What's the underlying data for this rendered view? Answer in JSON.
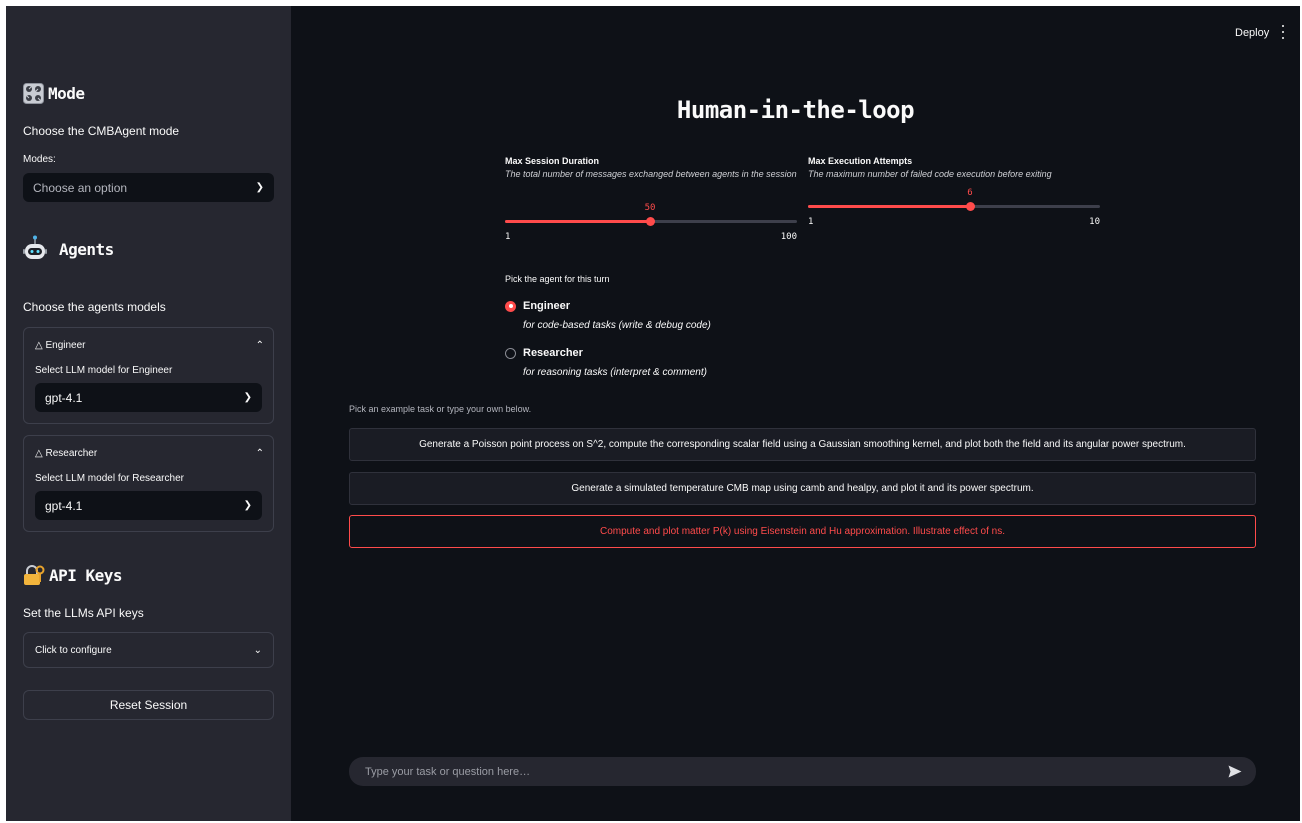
{
  "colors": {
    "accent": "#ff4b4b",
    "sidebar_bg": "#262730",
    "main_bg": "#0e1117"
  },
  "sidebar": {
    "mode": {
      "heading": "Mode",
      "icon": "control-knobs-icon",
      "subtitle": "Choose the CMBAgent mode",
      "select_label": "Modes:",
      "select_placeholder": "Choose an option"
    },
    "agents": {
      "heading": "Agents",
      "icon": "robot-icon",
      "subtitle": "Choose the agents models",
      "expanders": [
        {
          "title": "Engineer",
          "select_label": "Select LLM model for Engineer",
          "value": "gpt-4.1"
        },
        {
          "title": "Researcher",
          "select_label": "Select LLM model for Researcher",
          "value": "gpt-4.1"
        }
      ]
    },
    "api_keys": {
      "heading": "API Keys",
      "icon": "lock-key-icon",
      "subtitle": "Set the LLMs API keys",
      "configure_label": "Click to configure"
    },
    "reset_label": "Reset Session"
  },
  "header": {
    "deploy_label": "Deploy",
    "menu_icon": "kebab-menu-icon"
  },
  "main": {
    "title": "Human-in-the-loop",
    "sliders": [
      {
        "label": "Max Session Duration",
        "help": "The total number of messages exchanged between agents in the session",
        "value": "50",
        "min": "1",
        "max": "100",
        "fraction": 0.495
      },
      {
        "label": "Max Execution Attempts",
        "help": "The maximum number of failed code execution before exiting",
        "value": "6",
        "min": "1",
        "max": "10",
        "fraction": 0.555
      }
    ],
    "agent_pick": {
      "label": "Pick the agent for this turn",
      "options": [
        {
          "title": "Engineer",
          "desc": "for code-based tasks (write & debug code)",
          "selected": true
        },
        {
          "title": "Researcher",
          "desc": "for reasoning tasks (interpret & comment)",
          "selected": false
        }
      ]
    },
    "examples_label": "Pick an example task or type your own below.",
    "example_tasks": [
      "Generate a Poisson point process on S^2, compute the corresponding scalar field using a Gaussian smoothing kernel, and plot both the field and its angular power spectrum.",
      "Generate a simulated temperature CMB map using camb and healpy, and plot it and its power spectrum.",
      "Compute and plot matter P(k) using Eisenstein and Hu approximation. Illustrate effect of ns."
    ],
    "chat_placeholder": "Type your task or question here…",
    "send_icon": "send-arrow-icon"
  }
}
